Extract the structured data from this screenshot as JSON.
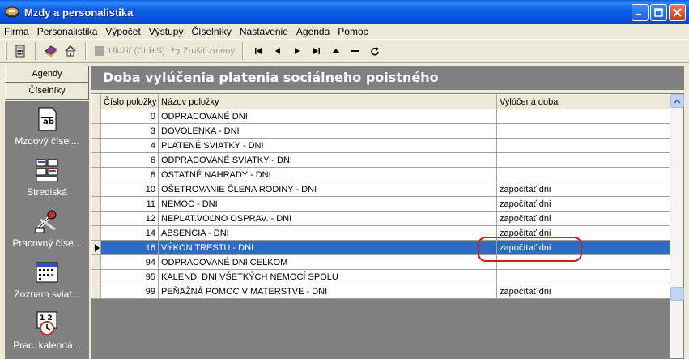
{
  "window": {
    "title": "Mzdy a personalistika"
  },
  "menu": [
    {
      "label": "Firma",
      "u": "F",
      "rest": "irma"
    },
    {
      "label": "Personalistika",
      "u": "P",
      "rest": "ersonalistika"
    },
    {
      "label": "Výpočet",
      "u": "V",
      "rest": "ýpočet"
    },
    {
      "label": "Výstupy",
      "u": "V",
      "rest": "ýstupy"
    },
    {
      "label": "Číselníky",
      "u": "Č",
      "rest": "íselníky"
    },
    {
      "label": "Nastavenie",
      "u": "N",
      "rest": "astavenie"
    },
    {
      "label": "Agenda",
      "u": "A",
      "rest": "genda"
    },
    {
      "label": "Pomoc",
      "u": "P",
      "rest": "omoc"
    }
  ],
  "toolbar": {
    "save_label": "Uložiť (Ctrl+S)",
    "undo_label": "Zrušiť zmeny"
  },
  "left_panel": {
    "agendy": "Agendy",
    "ciselniky": "Číselníky",
    "items": [
      {
        "label": "Mzdový čísel...",
        "icon": "document-ab-icon"
      },
      {
        "label": "Strediská",
        "icon": "org-chart-icon"
      },
      {
        "label": "Pracovný číse...",
        "icon": "tools-icon"
      },
      {
        "label": "Zoznam sviat...",
        "icon": "calendar-icon"
      },
      {
        "label": "Prac. kalendá...",
        "icon": "calendar-clock-icon"
      }
    ]
  },
  "main": {
    "header": "Doba vylúčenia platenia sociálneho poistného",
    "columns": [
      "Číslo položky",
      "Názov položky",
      "Vylúčená doba"
    ],
    "rows": [
      {
        "num": "0",
        "name": "ODPRACOVANÉ DNI",
        "value": ""
      },
      {
        "num": "3",
        "name": "DOVOLENKA - DNI",
        "value": ""
      },
      {
        "num": "4",
        "name": "PLATENÉ SVIATKY - DNI",
        "value": ""
      },
      {
        "num": "6",
        "name": "ODPRACOVANÉ SVIATKY - DNI",
        "value": ""
      },
      {
        "num": "8",
        "name": "OSTATNÉ NAHRADY - DNI",
        "value": ""
      },
      {
        "num": "10",
        "name": "OŠETROVANIE ČLENA RODINY - DNI",
        "value": "započítať dni"
      },
      {
        "num": "11",
        "name": "NEMOC - DNI",
        "value": "započítať dni"
      },
      {
        "num": "12",
        "name": "NEPLAT.VOĽNO OSPRAV. - DNI",
        "value": "započítať dni"
      },
      {
        "num": "14",
        "name": "ABSENCIA - DNI",
        "value": "započítať dni"
      },
      {
        "num": "16",
        "name": "VÝKON TRESTU - DNI",
        "value": "započítať dni",
        "selected": true
      },
      {
        "num": "94",
        "name": "ODPRACOVANÉ DNI CELKOM",
        "value": ""
      },
      {
        "num": "95",
        "name": "KALEND. DNI VŠETKÝCH NEMOCÍ SPOLU",
        "value": ""
      },
      {
        "num": "99",
        "name": "PEŇAŽNÁ POMOC V MATERSTVE - DNI",
        "value": "započítať dni"
      }
    ]
  },
  "colors": {
    "selection": "#316ac5",
    "title_bar": "#0a4fd6",
    "highlight": "#e0141a"
  }
}
